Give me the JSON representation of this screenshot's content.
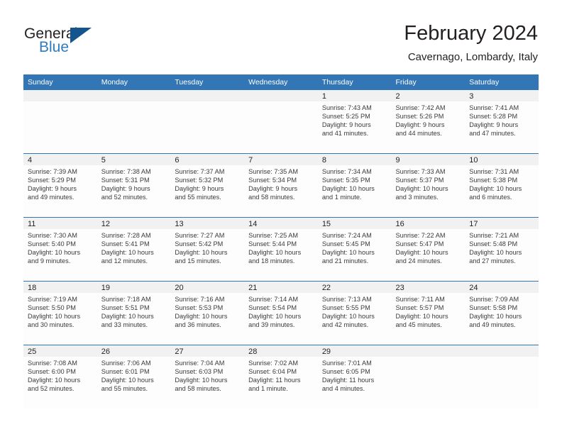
{
  "brand": {
    "name_part1": "General",
    "name_part2": "Blue",
    "flag_icon": "flag-triangle-icon",
    "colors": {
      "dark_blue": "#14558f",
      "light_blue": "#2c7cc0"
    }
  },
  "header": {
    "title": "February 2024",
    "subtitle": "Cavernago, Lombardy, Italy"
  },
  "theme": {
    "header_blue": "#3376b6",
    "daynum_band": "#f1f1f1",
    "cell_bg": "#fdfdfd",
    "text": "#231f20"
  },
  "weekday_headers": [
    "Sunday",
    "Monday",
    "Tuesday",
    "Wednesday",
    "Thursday",
    "Friday",
    "Saturday"
  ],
  "labels": {
    "sunrise_prefix": "Sunrise:",
    "sunset_prefix": "Sunset:",
    "daylight_prefix": "Daylight:"
  },
  "weeks": [
    [
      {
        "day": "",
        "empty": true
      },
      {
        "day": "",
        "empty": true
      },
      {
        "day": "",
        "empty": true
      },
      {
        "day": "",
        "empty": true
      },
      {
        "day": "1",
        "sunrise": "Sunrise: 7:43 AM",
        "sunset": "Sunset: 5:25 PM",
        "daylight_line1": "Daylight: 9 hours",
        "daylight_line2": "and 41 minutes."
      },
      {
        "day": "2",
        "sunrise": "Sunrise: 7:42 AM",
        "sunset": "Sunset: 5:26 PM",
        "daylight_line1": "Daylight: 9 hours",
        "daylight_line2": "and 44 minutes."
      },
      {
        "day": "3",
        "sunrise": "Sunrise: 7:41 AM",
        "sunset": "Sunset: 5:28 PM",
        "daylight_line1": "Daylight: 9 hours",
        "daylight_line2": "and 47 minutes."
      }
    ],
    [
      {
        "day": "4",
        "sunrise": "Sunrise: 7:39 AM",
        "sunset": "Sunset: 5:29 PM",
        "daylight_line1": "Daylight: 9 hours",
        "daylight_line2": "and 49 minutes."
      },
      {
        "day": "5",
        "sunrise": "Sunrise: 7:38 AM",
        "sunset": "Sunset: 5:31 PM",
        "daylight_line1": "Daylight: 9 hours",
        "daylight_line2": "and 52 minutes."
      },
      {
        "day": "6",
        "sunrise": "Sunrise: 7:37 AM",
        "sunset": "Sunset: 5:32 PM",
        "daylight_line1": "Daylight: 9 hours",
        "daylight_line2": "and 55 minutes."
      },
      {
        "day": "7",
        "sunrise": "Sunrise: 7:35 AM",
        "sunset": "Sunset: 5:34 PM",
        "daylight_line1": "Daylight: 9 hours",
        "daylight_line2": "and 58 minutes."
      },
      {
        "day": "8",
        "sunrise": "Sunrise: 7:34 AM",
        "sunset": "Sunset: 5:35 PM",
        "daylight_line1": "Daylight: 10 hours",
        "daylight_line2": "and 1 minute."
      },
      {
        "day": "9",
        "sunrise": "Sunrise: 7:33 AM",
        "sunset": "Sunset: 5:37 PM",
        "daylight_line1": "Daylight: 10 hours",
        "daylight_line2": "and 3 minutes."
      },
      {
        "day": "10",
        "sunrise": "Sunrise: 7:31 AM",
        "sunset": "Sunset: 5:38 PM",
        "daylight_line1": "Daylight: 10 hours",
        "daylight_line2": "and 6 minutes."
      }
    ],
    [
      {
        "day": "11",
        "sunrise": "Sunrise: 7:30 AM",
        "sunset": "Sunset: 5:40 PM",
        "daylight_line1": "Daylight: 10 hours",
        "daylight_line2": "and 9 minutes."
      },
      {
        "day": "12",
        "sunrise": "Sunrise: 7:28 AM",
        "sunset": "Sunset: 5:41 PM",
        "daylight_line1": "Daylight: 10 hours",
        "daylight_line2": "and 12 minutes."
      },
      {
        "day": "13",
        "sunrise": "Sunrise: 7:27 AM",
        "sunset": "Sunset: 5:42 PM",
        "daylight_line1": "Daylight: 10 hours",
        "daylight_line2": "and 15 minutes."
      },
      {
        "day": "14",
        "sunrise": "Sunrise: 7:25 AM",
        "sunset": "Sunset: 5:44 PM",
        "daylight_line1": "Daylight: 10 hours",
        "daylight_line2": "and 18 minutes."
      },
      {
        "day": "15",
        "sunrise": "Sunrise: 7:24 AM",
        "sunset": "Sunset: 5:45 PM",
        "daylight_line1": "Daylight: 10 hours",
        "daylight_line2": "and 21 minutes."
      },
      {
        "day": "16",
        "sunrise": "Sunrise: 7:22 AM",
        "sunset": "Sunset: 5:47 PM",
        "daylight_line1": "Daylight: 10 hours",
        "daylight_line2": "and 24 minutes."
      },
      {
        "day": "17",
        "sunrise": "Sunrise: 7:21 AM",
        "sunset": "Sunset: 5:48 PM",
        "daylight_line1": "Daylight: 10 hours",
        "daylight_line2": "and 27 minutes."
      }
    ],
    [
      {
        "day": "18",
        "sunrise": "Sunrise: 7:19 AM",
        "sunset": "Sunset: 5:50 PM",
        "daylight_line1": "Daylight: 10 hours",
        "daylight_line2": "and 30 minutes."
      },
      {
        "day": "19",
        "sunrise": "Sunrise: 7:18 AM",
        "sunset": "Sunset: 5:51 PM",
        "daylight_line1": "Daylight: 10 hours",
        "daylight_line2": "and 33 minutes."
      },
      {
        "day": "20",
        "sunrise": "Sunrise: 7:16 AM",
        "sunset": "Sunset: 5:53 PM",
        "daylight_line1": "Daylight: 10 hours",
        "daylight_line2": "and 36 minutes."
      },
      {
        "day": "21",
        "sunrise": "Sunrise: 7:14 AM",
        "sunset": "Sunset: 5:54 PM",
        "daylight_line1": "Daylight: 10 hours",
        "daylight_line2": "and 39 minutes."
      },
      {
        "day": "22",
        "sunrise": "Sunrise: 7:13 AM",
        "sunset": "Sunset: 5:55 PM",
        "daylight_line1": "Daylight: 10 hours",
        "daylight_line2": "and 42 minutes."
      },
      {
        "day": "23",
        "sunrise": "Sunrise: 7:11 AM",
        "sunset": "Sunset: 5:57 PM",
        "daylight_line1": "Daylight: 10 hours",
        "daylight_line2": "and 45 minutes."
      },
      {
        "day": "24",
        "sunrise": "Sunrise: 7:09 AM",
        "sunset": "Sunset: 5:58 PM",
        "daylight_line1": "Daylight: 10 hours",
        "daylight_line2": "and 49 minutes."
      }
    ],
    [
      {
        "day": "25",
        "sunrise": "Sunrise: 7:08 AM",
        "sunset": "Sunset: 6:00 PM",
        "daylight_line1": "Daylight: 10 hours",
        "daylight_line2": "and 52 minutes."
      },
      {
        "day": "26",
        "sunrise": "Sunrise: 7:06 AM",
        "sunset": "Sunset: 6:01 PM",
        "daylight_line1": "Daylight: 10 hours",
        "daylight_line2": "and 55 minutes."
      },
      {
        "day": "27",
        "sunrise": "Sunrise: 7:04 AM",
        "sunset": "Sunset: 6:03 PM",
        "daylight_line1": "Daylight: 10 hours",
        "daylight_line2": "and 58 minutes."
      },
      {
        "day": "28",
        "sunrise": "Sunrise: 7:02 AM",
        "sunset": "Sunset: 6:04 PM",
        "daylight_line1": "Daylight: 11 hours",
        "daylight_line2": "and 1 minute."
      },
      {
        "day": "29",
        "sunrise": "Sunrise: 7:01 AM",
        "sunset": "Sunset: 6:05 PM",
        "daylight_line1": "Daylight: 11 hours",
        "daylight_line2": "and 4 minutes."
      },
      {
        "day": "",
        "empty": true
      },
      {
        "day": "",
        "empty": true
      }
    ]
  ]
}
